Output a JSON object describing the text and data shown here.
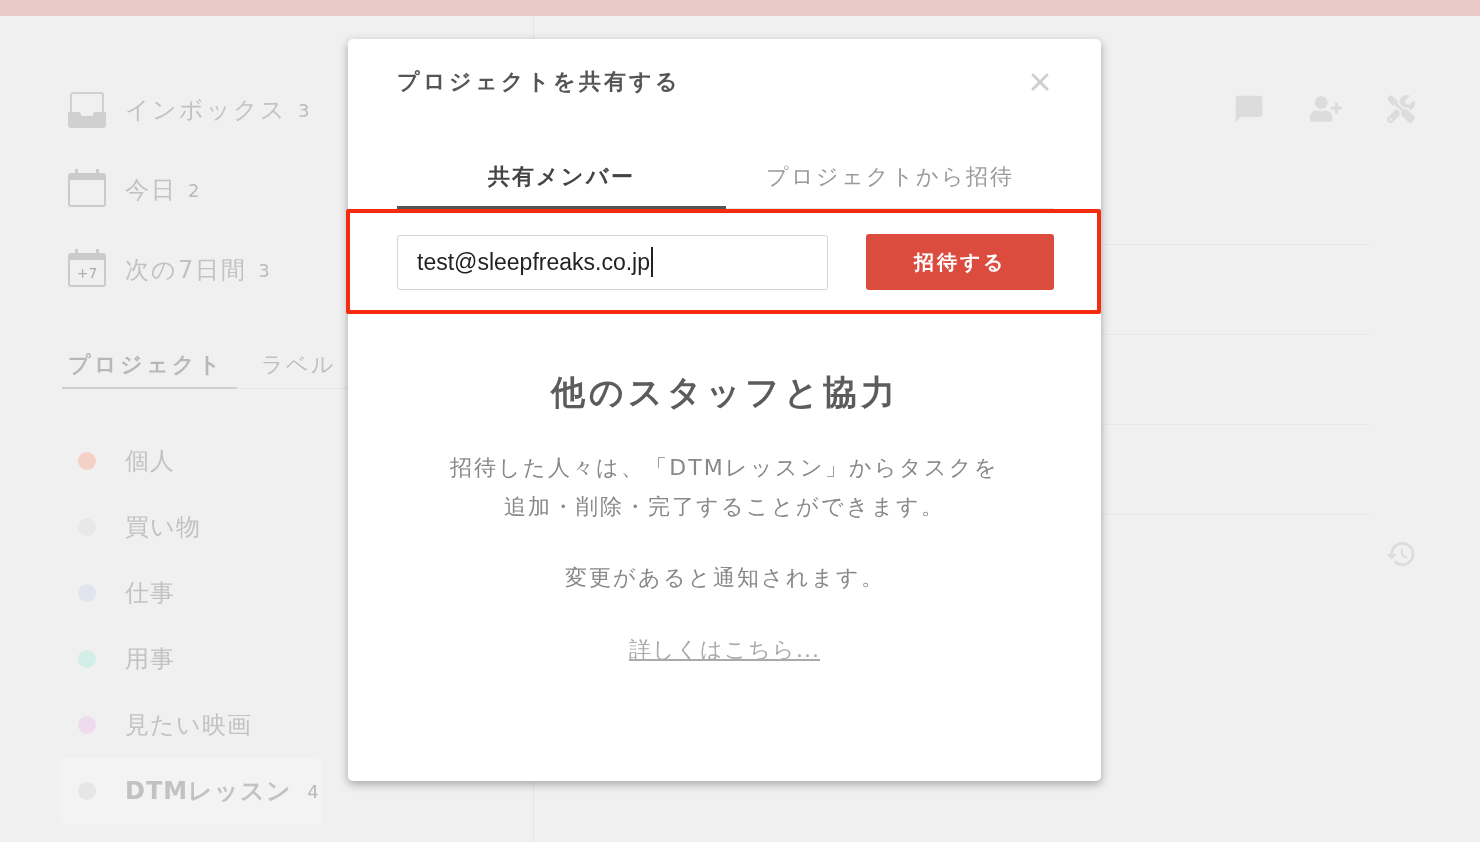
{
  "sidebar": {
    "filters": [
      {
        "kind": "inbox",
        "label": "インボックス",
        "count": "3"
      },
      {
        "kind": "today",
        "label": "今日",
        "count": "2"
      },
      {
        "kind": "upcoming",
        "label": "次の7日間",
        "count": "3",
        "icon_text": "+7"
      }
    ],
    "tabs": [
      {
        "label": "プロジェクト",
        "selected": true
      },
      {
        "label": "ラベル",
        "selected": false
      }
    ],
    "projects": [
      {
        "name": "個人",
        "color": "#f5d0c5",
        "selected": false
      },
      {
        "name": "買い物",
        "color": "#e8e8e8",
        "selected": false
      },
      {
        "name": "仕事",
        "color": "#dfe4ee",
        "selected": false
      },
      {
        "name": "用事",
        "color": "#d2eee6",
        "selected": false
      },
      {
        "name": "見たい映画",
        "color": "#eedcee",
        "selected": false
      },
      {
        "name": "DTMレッスン",
        "color": "#e6e6e6",
        "selected": true,
        "count": "4"
      }
    ]
  },
  "dialog": {
    "title": "プロジェクトを共有する",
    "tabs": [
      {
        "label": "共有メンバー",
        "selected": true
      },
      {
        "label": "プロジェクトから招待",
        "selected": false
      }
    ],
    "invite": {
      "value": "test@sleepfreaks.co.jp",
      "focused": true,
      "button": "招待する"
    },
    "heading": "他のスタッフと協力",
    "paragraphs": [
      "招待した人々は、「DTMレッスン」からタスクを追加・削除・完了することができます。",
      "変更があると通知されます。"
    ],
    "link": "詳しくはこちら..."
  }
}
